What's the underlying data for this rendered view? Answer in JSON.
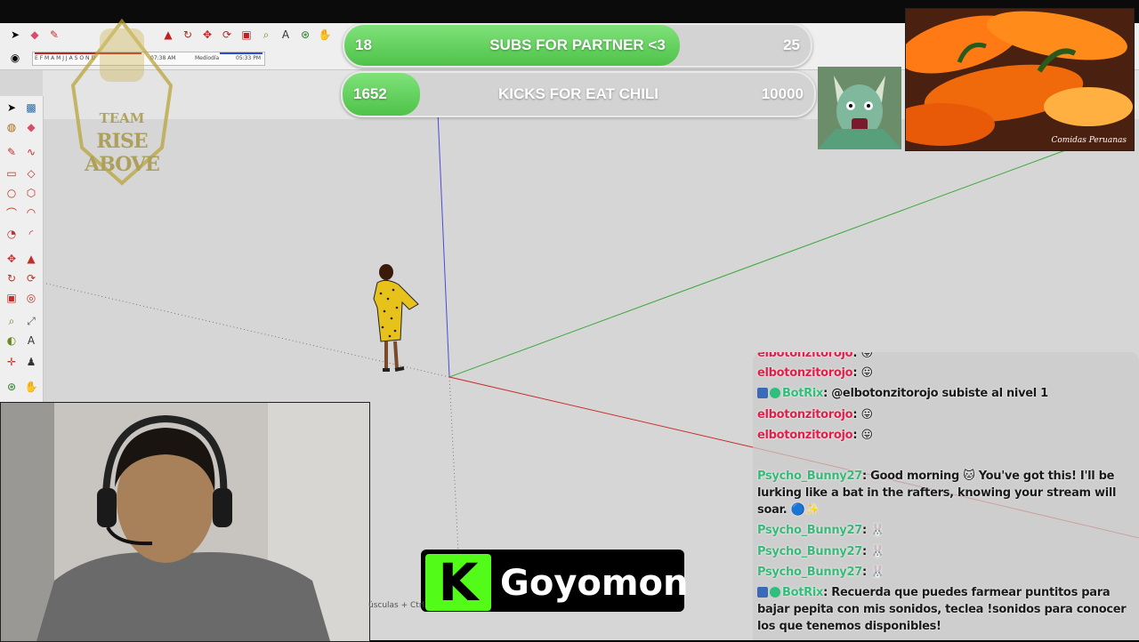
{
  "toolbar": {
    "tools": [
      "select-icon",
      "eraser-icon",
      "pencil-icon",
      "push-pull-icon",
      "rotate-icon",
      "move-icon",
      "paint-icon",
      "tape-icon",
      "text-icon",
      "orbit-icon"
    ],
    "shadow_times": [
      "07:38 AM",
      "Mediodía",
      "05:33 PM"
    ],
    "months": "E F M A M J J A S O N D"
  },
  "goals": {
    "subs": {
      "current": "18",
      "label": "SUBS FOR PARTNER <3",
      "target": "25",
      "progress": 0.72
    },
    "kicks": {
      "current": "1652",
      "label": "KICKS FOR EAT CHILI",
      "target": "10000",
      "progress": 0.165
    }
  },
  "overlay": {
    "team_logo_line1": "TEAM",
    "team_logo_line2": "RISE ABOVE",
    "pepper_caption": "Comidas Peruanas"
  },
  "kick": {
    "streamer": "Goyomon",
    "logo_letter": "K"
  },
  "status_hint": "úsculas + Ctrl",
  "chat": {
    "messages": [
      {
        "user": "elbotonzitorojo",
        "text": "",
        "emoji": "😛",
        "type": "red"
      },
      {
        "user": "elbotonzitorojo",
        "text": "",
        "emoji": "😛",
        "type": "red"
      },
      {
        "user": "BotRix",
        "text": "@elbotonzitorojo subiste al nivel 1",
        "emoji": "",
        "type": "bot"
      },
      {
        "user": "elbotonzitorojo",
        "text": "",
        "emoji": "😛",
        "type": "red"
      },
      {
        "user": "elbotonzitorojo",
        "text": "",
        "emoji": "😛",
        "type": "red"
      },
      {
        "user": "Psycho_Bunny27",
        "text": "Good morning 🐱 You've got this! I'll be lurking like a bat in the rafters, knowing your stream will soar. 🔵✨",
        "emoji": "",
        "type": "green"
      },
      {
        "user": "Psycho_Bunny27",
        "text": "",
        "emoji": "🐰",
        "type": "green"
      },
      {
        "user": "Psycho_Bunny27",
        "text": "",
        "emoji": "🐰",
        "type": "green"
      },
      {
        "user": "Psycho_Bunny27",
        "text": "",
        "emoji": "🐰",
        "type": "green"
      },
      {
        "user": "BotRix",
        "text": "Recuerda que puedes farmear puntitos para bajar pepita con mis sonidos, teclea !sonidos para conocer los que tenemos disponibles!",
        "emoji": "",
        "type": "bot"
      }
    ]
  },
  "colors": {
    "progress_green": "#5ccf55",
    "kick_green": "#53fc18",
    "axis_blue": "#4a4ad8",
    "axis_green": "#3aa83a",
    "axis_red": "#c83030"
  }
}
